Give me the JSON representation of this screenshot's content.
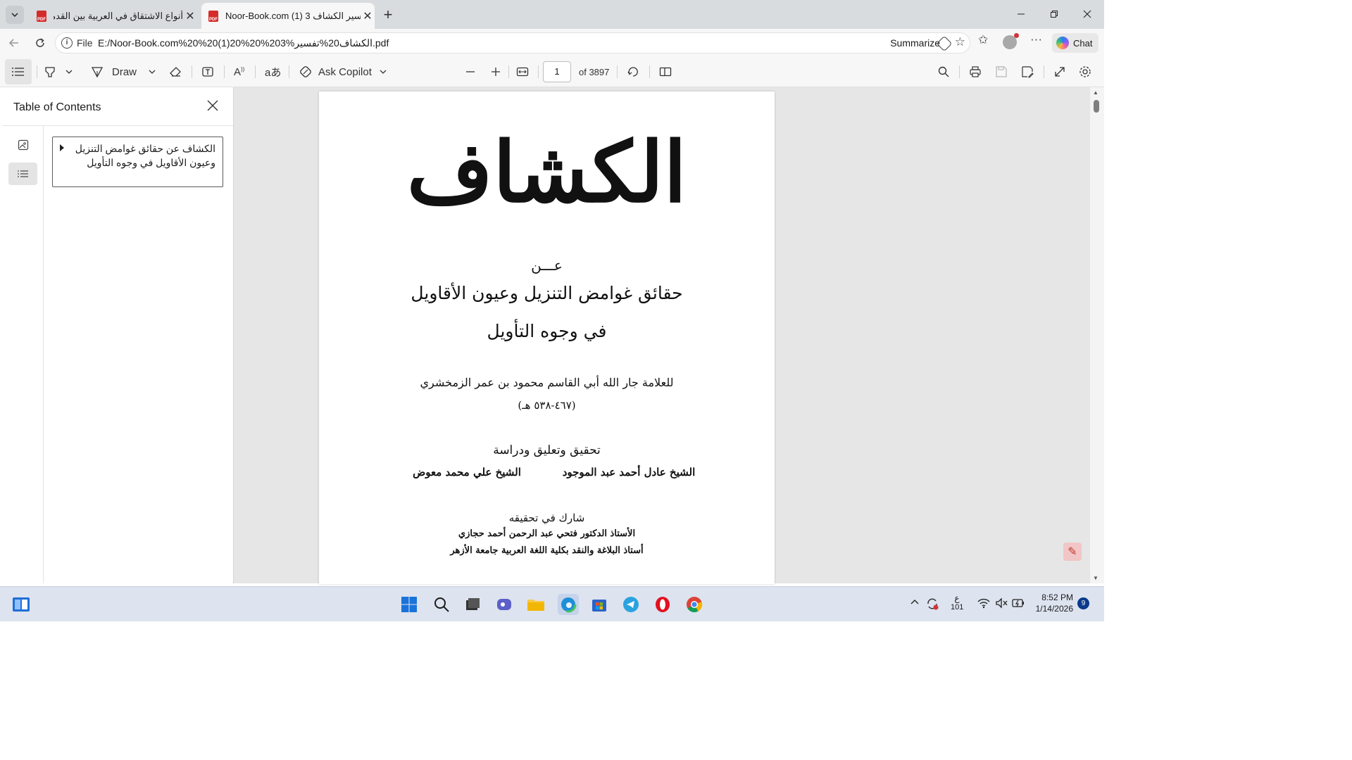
{
  "browser": {
    "tabs": [
      {
        "title": "أنواع الاشتقاق في العربية بين القدماء",
        "active": false
      },
      {
        "title": "Noor-Book.com (1) 3 تفسير الكشاف",
        "active": true
      }
    ],
    "new_tab": "+",
    "address": {
      "scheme_label": "File",
      "url": "E:/Noor-Book.com%20%20(1)20%20%203%الكشاف20%تفسير.pdf",
      "summarize_label": "Summarize"
    },
    "chat_label": "Chat"
  },
  "pdf_toolbar": {
    "draw_label": "Draw",
    "copilot_label": "Ask Copilot",
    "page_number": "1",
    "page_count": "of 3897"
  },
  "sidebar": {
    "title": "Table of Contents",
    "toc_items": [
      {
        "label": "الكشاف عن حقائق غوامض التنزيل وعيون الأقاويل في وجوه التأويل"
      }
    ]
  },
  "document_page": {
    "main_title": "الكشاف",
    "an": "عـــن",
    "subtitle_1": "حقائق غوامض التنزيل وعيون الأقاويل",
    "subtitle_2": "في وجوه التأويل",
    "author": "للعلامة جار الله أبي القاسم محمود بن عمر الزمخشري",
    "author_dates": "(٤٦٧-٥٣٨ هـ)",
    "tahqiq": "تحقيق وتعليق ودراسة",
    "editor_1": "الشيخ عادل أحمد عبد الموجود",
    "editor_2": "الشيخ علي محمد معوض",
    "participated": "شارك في تحقيقه",
    "professor": "الأستاذ الدكتور فتحي عبد الرحمن أحمد حجازي",
    "professor_title": "أستاذ البلاغة والنقد بكلية اللغة العربية جامعة الأزهر"
  },
  "taskbar": {
    "language": "ع",
    "language_sub": "101",
    "time": "8:52 PM",
    "date": "1/14/2026",
    "notification_count": "9"
  },
  "colors": {
    "tabstrip": "#d9dcdf",
    "toolbar": "#f7f7f7",
    "doc_background": "#e6e6e6",
    "pdf_icon": "#d42b2b",
    "taskbar": "#dde3ef"
  }
}
